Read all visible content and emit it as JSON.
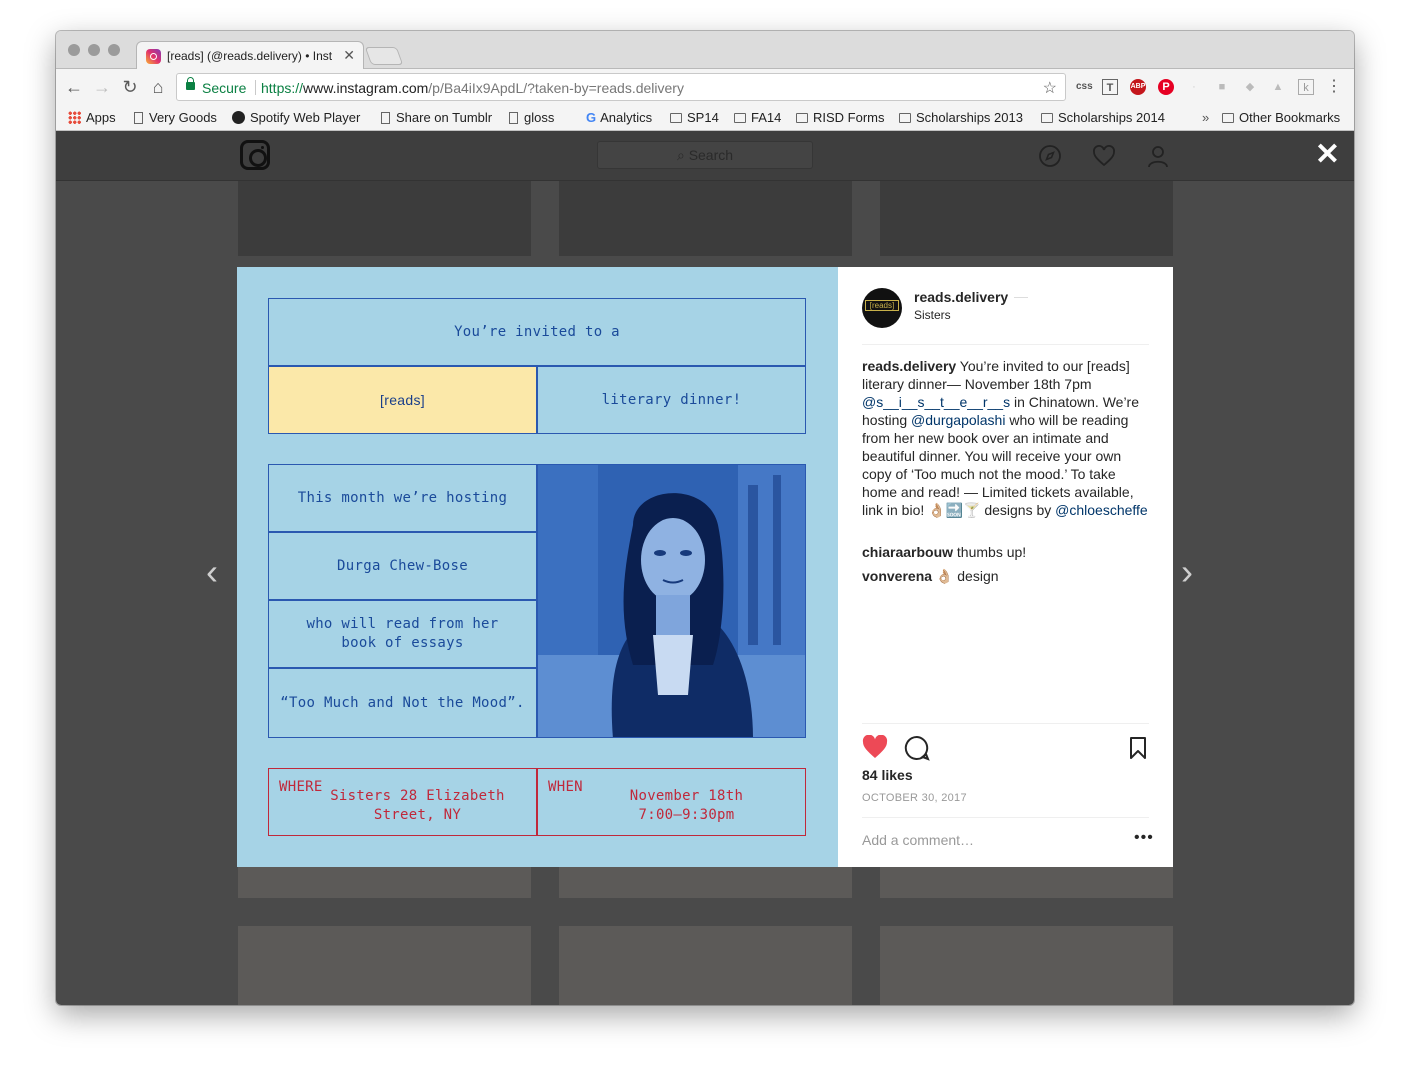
{
  "browser": {
    "tab_title": "[reads] (@reads.delivery) • Inst",
    "tab_close": "✕",
    "secure_label": "Secure",
    "url_proto": "https://",
    "url_host": "www.instagram.com",
    "url_path": "/p/Ba4iIx9ApdL/?taken-by=reads.delivery",
    "back": "←",
    "forward": "→",
    "reload": "↻",
    "home": "⌂",
    "star": "☆",
    "extensions": [
      "css",
      "T",
      "ABP",
      "P",
      "·",
      "■",
      "◆",
      "▲",
      "k",
      "⋮"
    ]
  },
  "bookmarks": {
    "apps": "Apps",
    "items": [
      "Very Goods",
      "Spotify Web Player",
      "Share on Tumblr",
      "gloss",
      "Analytics",
      "SP14",
      "FA14",
      "RISD Forms",
      "Scholarships 2013",
      "Scholarships 2014"
    ],
    "overflow": "»",
    "other": "Other Bookmarks"
  },
  "instagram": {
    "search_placeholder": "Search",
    "search_icon": "⌕",
    "close": "✕",
    "prev_arrow": "‹",
    "next_arrow": "›"
  },
  "poster": {
    "line1": "You’re invited to a",
    "reads": "[reads]",
    "literary": "literary dinner!",
    "hosting": "This month we’re hosting",
    "author": "Durga Chew-Bose",
    "read_from": "who will read from her book of essays",
    "book": "“Too Much and Not the Mood”.",
    "where_label": "WHERE",
    "where_value": "Sisters 28 Elizabeth Street, NY",
    "when_label": "WHEN",
    "when_value": "November 18th 7:00–9:30pm"
  },
  "post": {
    "username": "reads.delivery",
    "location": "Sisters",
    "avatar_text": "[reads]",
    "caption_user": "reads.delivery",
    "caption_1": " You’re invited to our [reads] literary dinner— November 18th 7pm ",
    "caption_mention1": "@s__i__s__t__e__r__s",
    "caption_2": " in Chinatown. We’re hosting ",
    "caption_mention2": "@durgapolashi",
    "caption_3": " who will be reading from her new book over an intimate and beautiful dinner. You will receive your own copy of ‘Too much not the mood.’ To take home and read! — Limited tickets available, link in bio! 👌🏼🔜🍸 designs by ",
    "caption_mention3": "@chloescheffe",
    "comments": [
      {
        "user": "chiaraarbouw",
        "text": " thumbs up!"
      },
      {
        "user": "vonverena",
        "text": " 👌🏼 design"
      }
    ],
    "likes": "84 likes",
    "date": "OCTOBER 30, 2017",
    "add_comment": "Add a comment…",
    "more": "•••",
    "colors": {
      "heart": "#ed4956",
      "poster_bg": "#a6d3e6",
      "poster_blue": "#2a58b0",
      "poster_red": "#c0283a",
      "poster_yellow": "#fbe8a9"
    }
  }
}
